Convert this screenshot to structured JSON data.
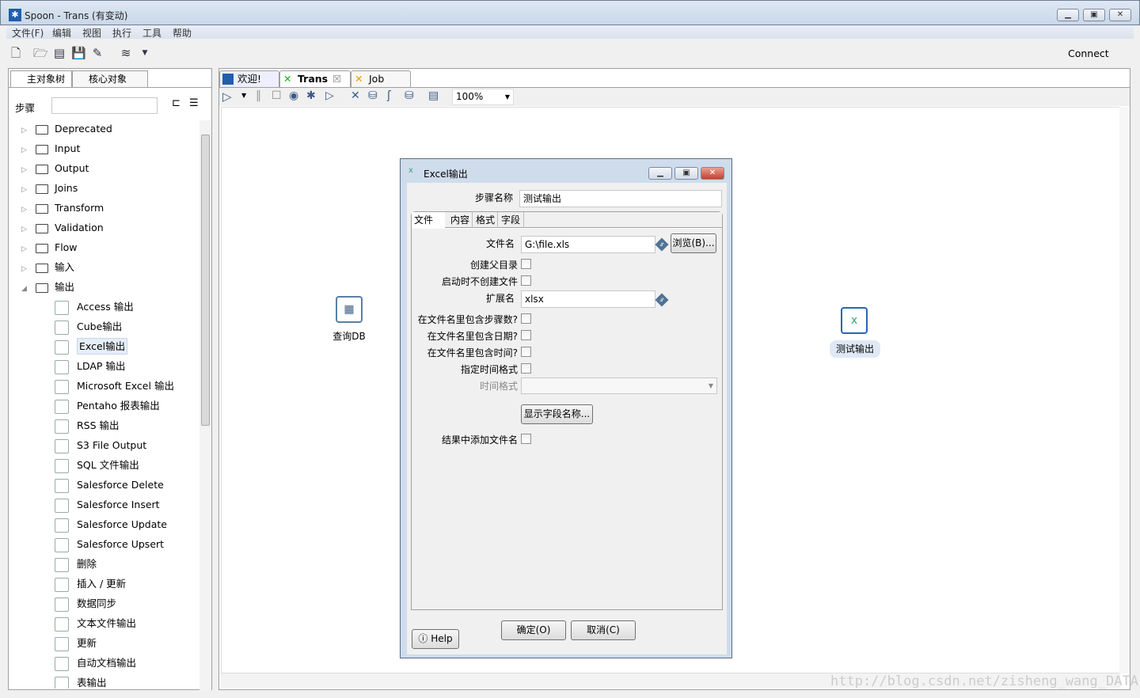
{
  "window": {
    "title": "Spoon - Trans (有变动)",
    "icon": "spoon-icon"
  },
  "menu": [
    "文件(F)",
    "编辑",
    "视图",
    "执行",
    "工具",
    "帮助"
  ],
  "toolbar": {
    "connect": "Connect"
  },
  "left": {
    "tabs": [
      "主对象树",
      "核心对象"
    ],
    "steps_label": "步骤",
    "search_value": "",
    "folders": [
      "Deprecated",
      "Input",
      "Output",
      "Joins",
      "Transform",
      "Validation",
      "Flow",
      "输入",
      "输出"
    ],
    "children": [
      "Access 输出",
      "Cube输出",
      "Excel输出",
      "LDAP 输出",
      "Microsoft Excel 输出",
      "Pentaho 报表输出",
      "RSS 输出",
      "S3 File Output",
      "SQL 文件输出",
      "Salesforce Delete",
      "Salesforce Insert",
      "Salesforce Update",
      "Salesforce Upsert",
      "删除",
      "插入 / 更新",
      "数据同步",
      "文本文件输出",
      "更新",
      "自动文档输出",
      "表输出"
    ],
    "selected": "Excel输出"
  },
  "editor": {
    "tabs": [
      "欢迎!",
      "Trans",
      "Job"
    ],
    "active_tab": "Trans",
    "zoom": "100%"
  },
  "canvas": {
    "steps": [
      "查询DB",
      "测试输出"
    ],
    "watermark": "http://blog.csdn.net/zisheng_wang_DATA"
  },
  "dialog": {
    "title": "Excel输出",
    "step_name_label": "步骤名称",
    "step_name": "测试输出",
    "tabs": [
      "文件",
      "内容",
      "格式",
      "字段"
    ],
    "active_tab": "文件",
    "filename_label": "文件名",
    "filename": "G:\\file.xls",
    "browse": "浏览(B)...",
    "create_parent": "创建父目录",
    "no_create_at_start": "启动时不创建文件",
    "extension_label": "扩展名",
    "extension": "xlsx",
    "include_stepnr": "在文件名里包含步骤数?",
    "include_date": "在文件名里包含日期?",
    "include_time": "在文件名里包含时间?",
    "specify_format": "指定时间格式",
    "date_format_label": "时间格式",
    "date_format": "",
    "show_fields": "显示字段名称...",
    "add_to_result": "结果中添加文件名",
    "help": "Help",
    "ok": "确定(O)",
    "cancel": "取消(C)"
  }
}
